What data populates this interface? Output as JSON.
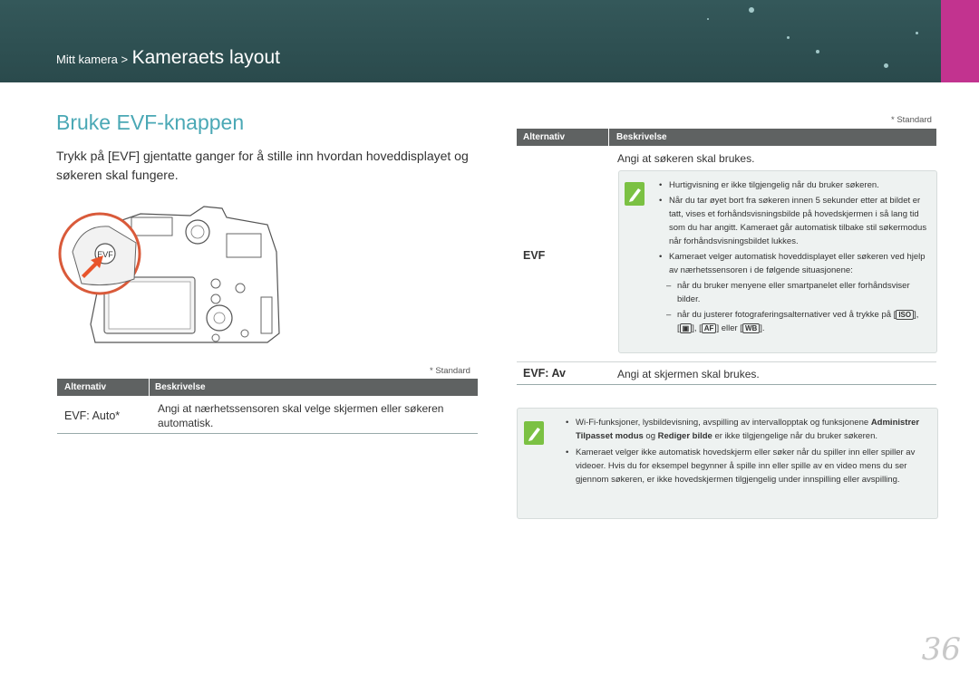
{
  "header": {
    "breadcrumb_small": "Mitt kamera >",
    "breadcrumb_big": "Kameraets layout",
    "accent": "#c2338f"
  },
  "title": "Bruke EVF-knappen",
  "intro": {
    "before": "Trykk på [",
    "key": "EVF",
    "after": "] gjentatte ganger for å stille inn hvordan hoveddisplayet og søkeren skal fungere."
  },
  "camera_image": {
    "icon": "camera-illustration",
    "button_label": "EVF"
  },
  "left_table": {
    "standard_note": "* Standard",
    "col_alternativ": "Alternativ",
    "col_beskrivelse": "Beskrivelse",
    "rows": [
      {
        "label": "EVF: Auto*",
        "text": "Angi at nærhetssensoren skal velge skjermen eller søkeren automatisk."
      }
    ]
  },
  "right_table": {
    "standard_note": "* Standard",
    "col_alternativ": "Alternativ",
    "col_beskrivelse": "Beskrivelse",
    "row1_label": "EVF",
    "row1_text": "Angi at søkeren skal brukes.",
    "row1_notes": {
      "b1": "Hurtigvisning er ikke tilgjengelig når du bruker søkeren.",
      "b2": "Når du tar øyet bort fra søkeren innen 5 sekunder etter at bildet er tatt, vises et forhåndsvisningsbilde på hovedskjermen i så lang tid som du har angitt. Kameraet går automatisk tilbake stil søkermodus når forhåndsvisningsbildet lukkes.",
      "b3": "Kameraet velger automatisk hoveddisplayet eller søkeren ved hjelp av nærhetssensoren i de følgende situasjonene:",
      "d1": "når du bruker menyene eller smartpanelet eller forhåndsviser bilder.",
      "d2_pre": "når du justerer fotograferingsalternativer ved å trykke på [",
      "k1": "ISO",
      "d2_mid1": "], [",
      "k2": "▣",
      "d2_mid2": "], [",
      "k3": "AF",
      "d2_mid3": "] eller [",
      "k4": "WB",
      "d2_post": "]."
    },
    "row2_label": "EVF: Av",
    "row2_text": "Angi at skjermen skal brukes."
  },
  "bottom_note": {
    "b1_pre": "Wi-Fi-funksjoner, lysbildevisning, avspilling av intervallopptak og funksjonene ",
    "b1_bold1": "Administrer Tilpasset modus",
    "b1_mid": " og ",
    "b1_bold2": "Rediger bilde",
    "b1_post": " er ikke tilgjengelige når du bruker søkeren.",
    "b2": "Kameraet velger ikke automatisk hovedskjerm eller søker når du spiller inn eller spiller av videoer. Hvis du for eksempel begynner å spille inn eller spille av en video mens du ser gjennom søkeren, er ikke hovedskjermen tilgjengelig under innspilling eller avspilling."
  },
  "page_number": "36"
}
